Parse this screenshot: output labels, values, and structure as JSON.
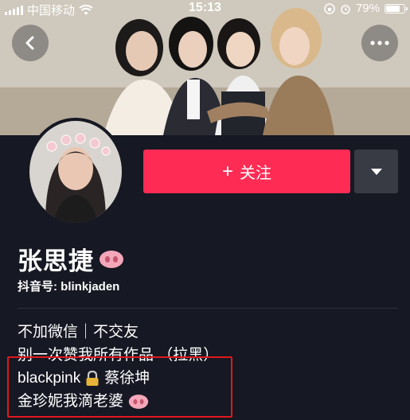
{
  "status_bar": {
    "carrier": "中国移动",
    "time": "15:13",
    "battery_percent": "79%",
    "battery_level": 0.79
  },
  "header": {
    "back_icon": "chevron-left-icon",
    "more_icon": "more-dots-icon"
  },
  "profile": {
    "name": "张思捷",
    "name_emoji": "pig-nose-icon",
    "id_label": "抖音号: blinkjaden"
  },
  "actions": {
    "follow_label": "关注",
    "follow_plus": "+",
    "dropdown_icon": "caret-down-icon"
  },
  "bio": {
    "line1": "不加微信｜不交友",
    "line2": "别一次赞我所有作品 （拉黑）",
    "line3_a": "blackpink",
    "line3_icon": "lock-icon",
    "line3_b": "蔡徐坤",
    "line4": "金珍妮我滴老婆",
    "line4_icon": "pig-nose-icon"
  },
  "colors": {
    "background": "#161823",
    "accent": "#fe2c55",
    "dropdown": "#393b44",
    "highlight": "#e0181d"
  }
}
